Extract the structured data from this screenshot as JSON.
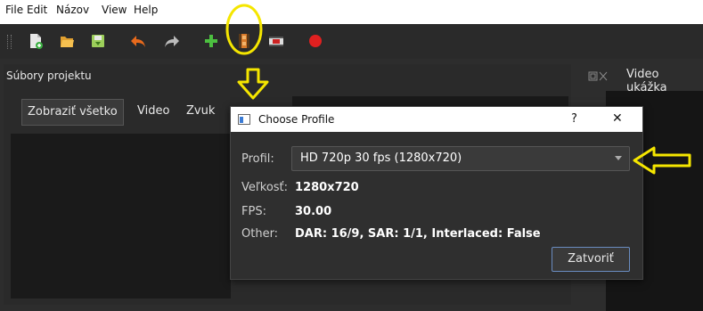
{
  "menu": {
    "items": [
      "File",
      "Edit",
      "Názov",
      "View",
      "Help"
    ]
  },
  "toolbar": {
    "icons": [
      "new-project-icon",
      "open-project-icon",
      "save-project-icon",
      "undo-icon",
      "redo-icon",
      "import-files-icon",
      "choose-profile-icon",
      "export-video-icon",
      "record-icon"
    ]
  },
  "panels": {
    "project_files_title": "Súbory projektu",
    "video_preview_title": "Video ukážka",
    "filters": [
      "Zobraziť všetko",
      "Video",
      "Zvuk"
    ]
  },
  "dialog": {
    "title": "Choose Profile",
    "help_label": "?",
    "close_label": "✕",
    "profile_label": "Profil:",
    "profile_value": "HD 720p 30 fps (1280x720)",
    "size_label": "Veľkosť:",
    "size_value": "1280x720",
    "fps_label": "FPS:",
    "fps_value": "30.00",
    "other_label": "Other:",
    "other_value": "DAR: 16/9, SAR: 1/1, Interlaced: False",
    "close_button": "Zatvoriť"
  },
  "colors": {
    "annotation": "#f5e600",
    "accent_border": "#6a8cc0",
    "record": "#e02020"
  }
}
